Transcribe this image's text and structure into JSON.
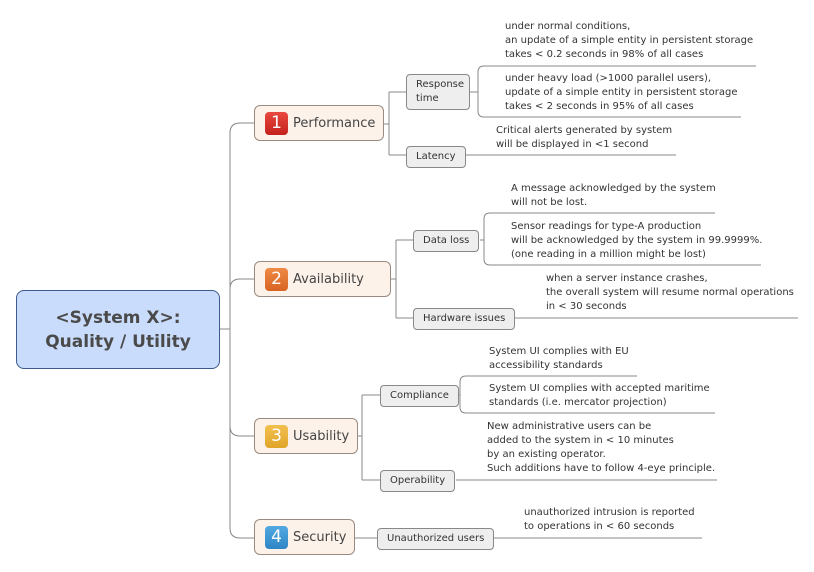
{
  "root": {
    "line1": "<System X>:",
    "line2": "Quality / Utility"
  },
  "branches": [
    {
      "number": "1",
      "label": "Performance",
      "badge_color": "#d9302a",
      "children": [
        {
          "label_line1": "Response",
          "label_line2": "time",
          "leaves": [
            [
              "under normal conditions,",
              "an update of a simple entity in persistent storage",
              "takes < 0.2 seconds in 98% of all cases"
            ],
            [
              "under heavy load (>1000 parallel users),",
              "update of a simple entity in persistent storage",
              "takes < 2 seconds in 95% of all cases"
            ]
          ]
        },
        {
          "label_line1": "Latency",
          "leaves": [
            [
              "Critical alerts generated by system",
              "will be displayed in <1 second"
            ]
          ]
        }
      ]
    },
    {
      "number": "2",
      "label": "Availability",
      "badge_color": "#e2722e",
      "children": [
        {
          "label_line1": "Data loss",
          "leaves": [
            [
              "A message acknowledged by the system",
              "will not be lost."
            ],
            [
              "Sensor readings for type-A production",
              "will be acknowledged by the system in 99.9999%.",
              "(one reading in a million might be lost)"
            ]
          ]
        },
        {
          "label_line1": "Hardware issues",
          "leaves": [
            [
              "when a server instance crashes,",
              "the overall system will resume normal operations",
              "in < 30 seconds"
            ]
          ]
        }
      ]
    },
    {
      "number": "3",
      "label": "Usability",
      "badge_color": "#eab03a",
      "children": [
        {
          "label_line1": "Compliance",
          "leaves": [
            [
              "System UI complies with EU",
              "accessibility standards"
            ],
            [
              "System UI complies with accepted maritime",
              "standards (i.e. mercator projection)"
            ]
          ]
        },
        {
          "label_line1": "Operability",
          "leaves": [
            [
              "New administrative users can be",
              "added to the system in < 10 minutes",
              "by an existing operator.",
              "Such additions have to follow 4-eye principle."
            ]
          ]
        }
      ]
    },
    {
      "number": "4",
      "label": "Security",
      "badge_color": "#3a94d4",
      "children": [
        {
          "label_line1": "Unauthorized users",
          "leaves": [
            [
              "unauthorized intrusion is reported",
              "to operations in < 60 seconds"
            ]
          ]
        }
      ]
    }
  ],
  "colors": {
    "line": "#888888",
    "root_fill": "#c9dcfb",
    "root_border": "#3c5a8a",
    "main_fill": "#fdf2ea",
    "sub_fill": "#eeeeee"
  }
}
